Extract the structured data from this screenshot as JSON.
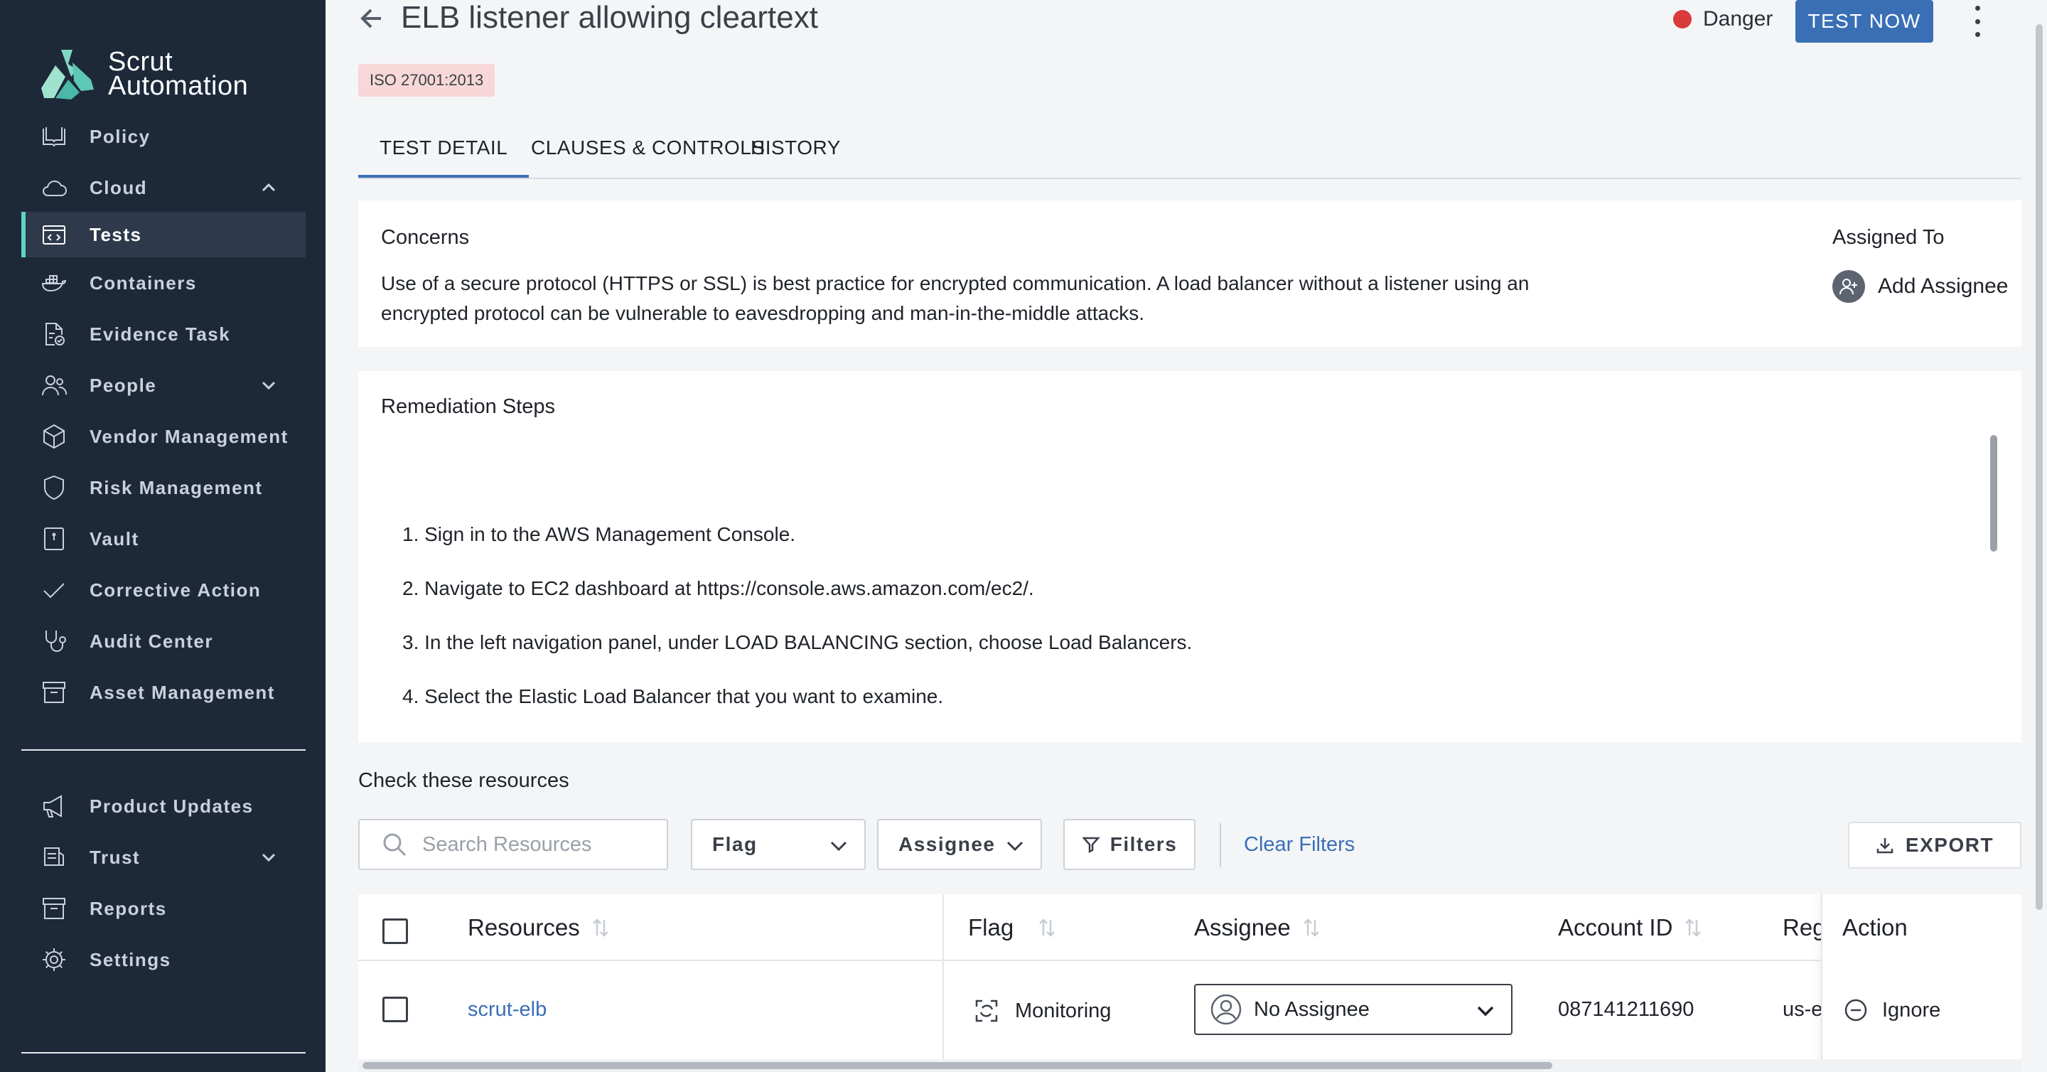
{
  "brand": {
    "line1": "Scrut",
    "line2": "Automation"
  },
  "sidebar": {
    "items": [
      {
        "label": "Policy",
        "icon": "book-open-icon"
      },
      {
        "label": "Cloud",
        "icon": "cloud-icon"
      },
      {
        "label": "Tests",
        "icon": "code-icon"
      },
      {
        "label": "Containers",
        "icon": "docker-icon"
      },
      {
        "label": "Evidence Task",
        "icon": "file-check-icon"
      },
      {
        "label": "People",
        "icon": "users-icon"
      },
      {
        "label": "Vendor Management",
        "icon": "cube-icon"
      },
      {
        "label": "Risk Management",
        "icon": "shield-icon"
      },
      {
        "label": "Vault",
        "icon": "vault-icon"
      },
      {
        "label": "Corrective Action",
        "icon": "check-icon"
      },
      {
        "label": "Audit Center",
        "icon": "stethoscope-icon"
      },
      {
        "label": "Asset Management",
        "icon": "archive-icon"
      }
    ],
    "bottom_items": [
      {
        "label": "Product Updates",
        "icon": "megaphone-icon"
      },
      {
        "label": "Trust",
        "icon": "trust-icon"
      },
      {
        "label": "Reports",
        "icon": "archive-icon"
      },
      {
        "label": "Settings",
        "icon": "gear-icon"
      }
    ],
    "active": "Tests"
  },
  "header": {
    "title": "ELB listener allowing cleartext",
    "status": "Danger",
    "status_color": "#d93a3a",
    "test_now": "TEST NOW",
    "badge": "ISO 27001:2013"
  },
  "tabs": [
    {
      "label": "TEST DETAIL",
      "active": true
    },
    {
      "label": "CLAUSES & CONTROLS",
      "active": false
    },
    {
      "label": "HISTORY",
      "active": false
    }
  ],
  "concerns": {
    "title": "Concerns",
    "text": "Use of a secure protocol (HTTPS or SSL) is best practice for encrypted communication. A load balancer without a listener using an encrypted protocol can be vulnerable to eavesdropping and man-in-the-middle attacks.",
    "assigned_to_title": "Assigned To",
    "add_assignee": "Add Assignee"
  },
  "remediation": {
    "title": "Remediation Steps",
    "steps": [
      "1. Sign in to the AWS Management Console.",
      "2. Navigate to EC2 dashboard at https://console.aws.amazon.com/ec2/.",
      "3. In the left navigation panel, under LOAD BALANCING section, choose Load Balancers.",
      "4. Select the Elastic Load Balancer that you want to examine."
    ]
  },
  "resources": {
    "title": "Check these resources",
    "search_placeholder": "Search Resources",
    "flag_select": "Flag",
    "assignee_select": "Assignee",
    "filters_button": "Filters",
    "clear_filters": "Clear Filters",
    "export_button": "EXPORT",
    "columns": {
      "resources": "Resources",
      "flag": "Flag",
      "assignee": "Assignee",
      "account_id": "Account ID",
      "region": "Reg",
      "action": "Action"
    },
    "rows": [
      {
        "resource": "scrut-elb",
        "flag": "Monitoring",
        "assignee": "No Assignee",
        "account_id": "087141211690",
        "region": "us-e",
        "action": "Ignore"
      }
    ]
  }
}
